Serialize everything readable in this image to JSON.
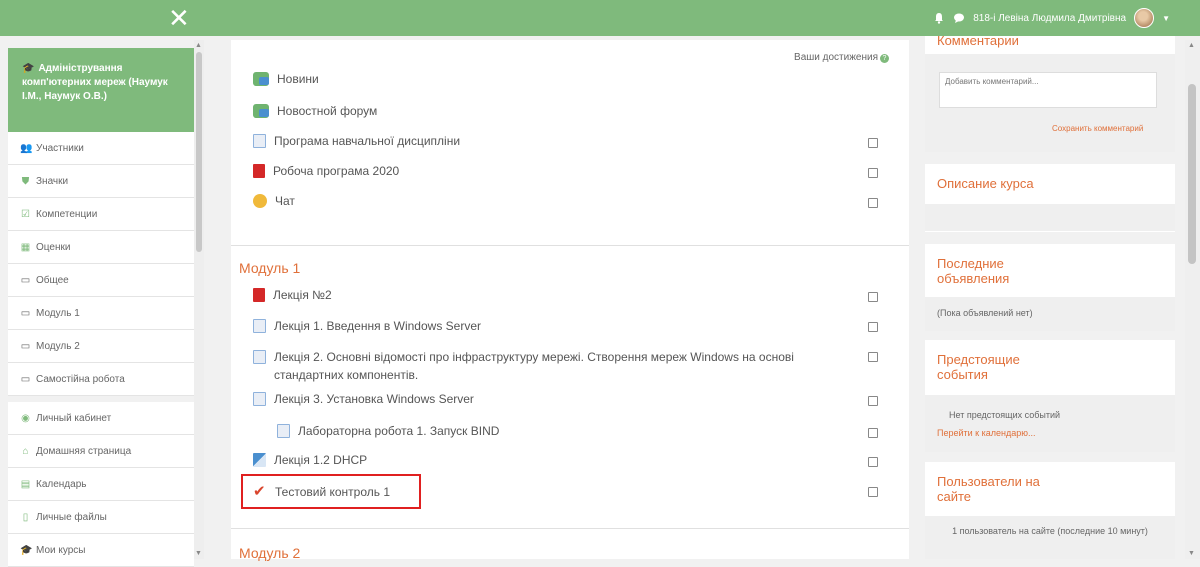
{
  "topbar": {
    "close_glyph": "✕",
    "user_name": "818-і Левіна Людмила Дмитрівна",
    "bell_icon": "bell-icon",
    "chat_icon": "chat-icon"
  },
  "sidebar": {
    "course_title": "Адміністрування комп'ютерних мереж (Наумук І.М., Наумук О.В.)",
    "items": [
      {
        "label": "Участники",
        "icon": "users-icon"
      },
      {
        "label": "Значки",
        "icon": "badge-icon"
      },
      {
        "label": "Компетенции",
        "icon": "checkbox-icon"
      },
      {
        "label": "Оценки",
        "icon": "grid-icon"
      },
      {
        "label": "Общее",
        "icon": "folder-icon"
      },
      {
        "label": "Модуль 1",
        "icon": "folder-icon"
      },
      {
        "label": "Модуль 2",
        "icon": "folder-icon"
      },
      {
        "label": "Самостійна робота",
        "icon": "folder-icon"
      }
    ],
    "items2": [
      {
        "label": "Личный кабинет",
        "icon": "dashboard-icon"
      },
      {
        "label": "Домашняя страница",
        "icon": "home-icon"
      },
      {
        "label": "Календарь",
        "icon": "calendar-icon"
      },
      {
        "label": "Личные файлы",
        "icon": "file-icon"
      },
      {
        "label": "Мои курсы",
        "icon": "graduation-cap-icon"
      }
    ]
  },
  "main": {
    "achievements": "Ваши достижения",
    "general": [
      {
        "label": "Новини",
        "type": "forum"
      },
      {
        "label": "Новостной форум",
        "type": "forum"
      },
      {
        "label": "Програма навчальної дисципліни",
        "type": "page"
      },
      {
        "label": "Робоча програма 2020",
        "type": "pdf"
      },
      {
        "label": "Чат",
        "type": "chat"
      }
    ],
    "module1_title": "Модуль 1",
    "module1": [
      {
        "label": "Лекція №2",
        "type": "pdf"
      },
      {
        "label": "Лекція 1. Введення в Windows Server",
        "type": "page"
      },
      {
        "label": "Лекція 2. Основні відомості про інфраструктуру мережі. Створення мереж Windows на основі стандартних компонентів.",
        "type": "page"
      },
      {
        "label": "Лекція 3. Установка Windows Server",
        "type": "page"
      },
      {
        "label": "Лабораторна робота 1. Запуск BIND",
        "type": "page"
      },
      {
        "label": "Лекція 1.2 DHCP",
        "type": "file"
      },
      {
        "label": "Тестовий контроль 1",
        "type": "quiz"
      }
    ],
    "module2_title": "Модуль 2"
  },
  "right": {
    "comments_title": "Комментарии",
    "comment_placeholder": "Добавить комментарий...",
    "save_comment": "Сохранить комментарий",
    "course_desc_title": "Описание курса",
    "announcements_title": "Последние объявления",
    "announcements_empty": "(Пока объявлений нет)",
    "events_title": "Предстоящие события",
    "events_empty": "Нет предстоящих событий",
    "calendar_link": "Перейти к календарю...",
    "online_title": "Пользователи на сайте",
    "online_text": "1 пользователь на сайте (последние 10 минут)"
  },
  "colors": {
    "accent": "#7fba7c",
    "link": "#e0703a",
    "highlight_box": "#e02020"
  }
}
